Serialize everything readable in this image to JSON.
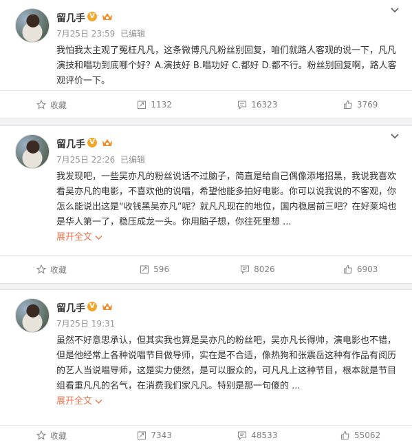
{
  "posts": [
    {
      "author": "留几手",
      "time": "7月25日 23:59",
      "edited": "已编辑",
      "text": "我怕我太主观了冤枉凡凡，这条微博凡凡粉丝别回复，咱们就路人客观的说一下，凡凡演技和唱功到底哪个好？A.演技好 B.唱功好 C.都好 D.都不行。粉丝别回复啊，路人客观评价一下。",
      "expand": "",
      "favorite": "收藏",
      "reposts": "1132",
      "comments": "16323",
      "likes": "3769"
    },
    {
      "author": "留几手",
      "time": "7月25日 22:26",
      "edited": "已编辑",
      "text": "我发现吧，一些吴亦凡的粉丝说话不过脑子，简直是给自己偶像添堵招黑，我说我喜欢看吴亦凡的电影，不喜欢他的说唱，希望他能多拍好电影。你可以说我说的不客观，你怎么能说出这是“收钱黑吴亦凡”呢？就凡凡现在的地位，国内稳居前三吧？在好莱坞也是华人第一了，稳压成龙一头。你用脑子想，你往死里想 ...",
      "expand": "展开全文",
      "favorite": "收藏",
      "reposts": "596",
      "comments": "8026",
      "likes": "6903"
    },
    {
      "author": "留几手",
      "time": "7月25日 19:31",
      "edited": "",
      "text": "虽然不好意思承认，但其实我也算是吴亦凡的粉丝吧，吴亦凡长得帅，演电影也不错，但是他经常上各种说唱节目做导师，实在是不合适，像热狗和张震岳这种有作品有阅历的艺人当说唱导师，这是实力使然，是可以服众的，可凡凡上这种节目，根本就是节目组看重凡凡的名气，在消费我们家凡凡。特别是那一句傻的 ...",
      "expand": "展开全文",
      "favorite": "收藏",
      "reposts": "7343",
      "comments": "48533",
      "likes": "55062"
    }
  ],
  "colors": {
    "link": "#eb7350",
    "badge": "#f2a62a",
    "muted": "#939393"
  },
  "icons": [
    "chevron-down-icon",
    "star-icon",
    "repost-icon",
    "comment-icon",
    "thumbs-up-icon",
    "verified-v-icon",
    "vip-crown-icon"
  ]
}
